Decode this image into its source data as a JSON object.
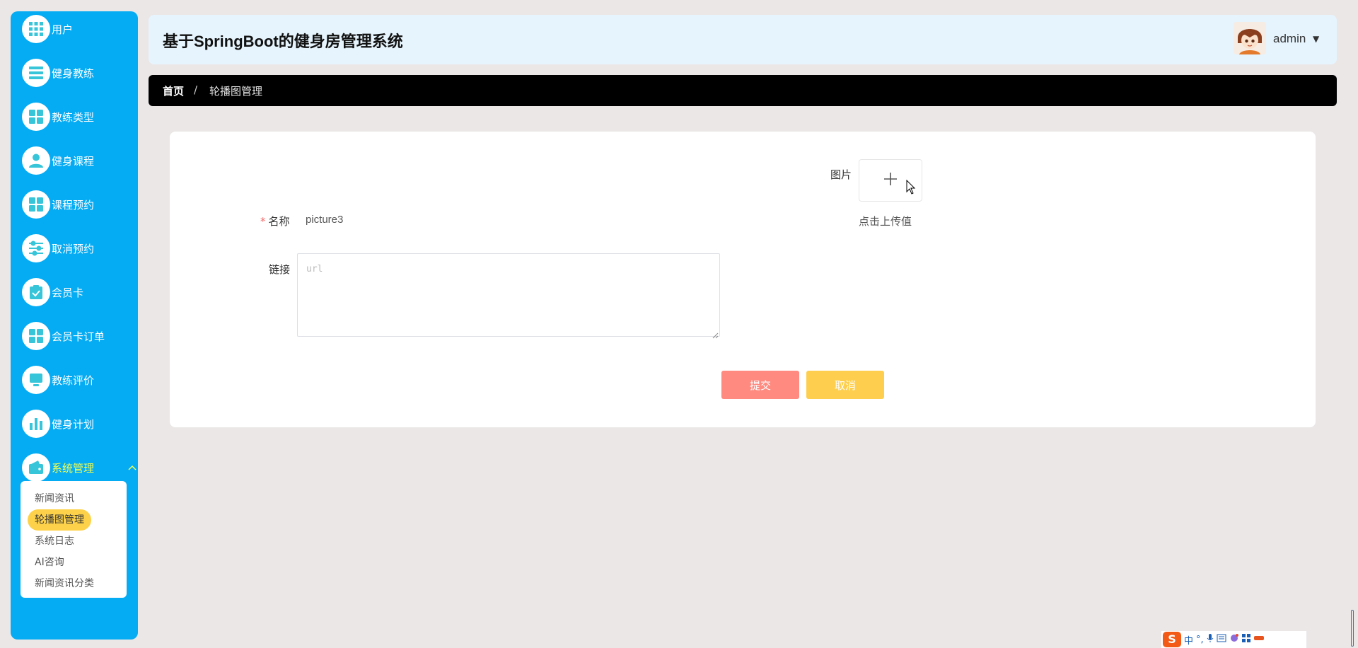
{
  "sidebar": {
    "items": [
      {
        "label": "用户",
        "icon": "grid-icon"
      },
      {
        "label": "健身教练",
        "icon": "list-icon"
      },
      {
        "label": "教练类型",
        "icon": "grid-icon"
      },
      {
        "label": "健身课程",
        "icon": "user-icon"
      },
      {
        "label": "课程预约",
        "icon": "grid-icon"
      },
      {
        "label": "取消预约",
        "icon": "sliders-icon"
      },
      {
        "label": "会员卡",
        "icon": "clipboard-check-icon"
      },
      {
        "label": "会员卡订单",
        "icon": "grid-icon"
      },
      {
        "label": "教练评价",
        "icon": "monitor-icon"
      },
      {
        "label": "健身计划",
        "icon": "bar-chart-icon"
      },
      {
        "label": "系统管理",
        "icon": "wallet-icon",
        "expanded": true
      }
    ],
    "submenu": [
      {
        "label": "新闻资讯"
      },
      {
        "label": "轮播图管理",
        "active": true
      },
      {
        "label": "系统日志"
      },
      {
        "label": "AI咨询"
      },
      {
        "label": "新闻资讯分类"
      }
    ],
    "expand_icon": "chevron-up-icon"
  },
  "header": {
    "title": "基于SpringBoot的健身房管理系统",
    "user": "admin",
    "caret": "▼"
  },
  "breadcrumb": {
    "home": "首页",
    "separator": "/",
    "current": "轮播图管理"
  },
  "form": {
    "name_label": "名称",
    "required_mark": "*",
    "name_value": "picture3",
    "link_label": "链接",
    "link_placeholder": "url",
    "image_label": "图片",
    "upload_hint": "点击上传值",
    "submit_label": "提交",
    "cancel_label": "取消"
  },
  "colors": {
    "sidebar_bg": "#05abf3",
    "active_text": "#f5ff4f",
    "submenu_active_bg": "#fdd24a",
    "header_bg": "#e6f4fd",
    "submit_bg": "#fe8a80",
    "cancel_bg": "#fecf4e",
    "page_bg": "#ebe7e7"
  },
  "ime": {
    "logo": "S",
    "mode": "中"
  }
}
